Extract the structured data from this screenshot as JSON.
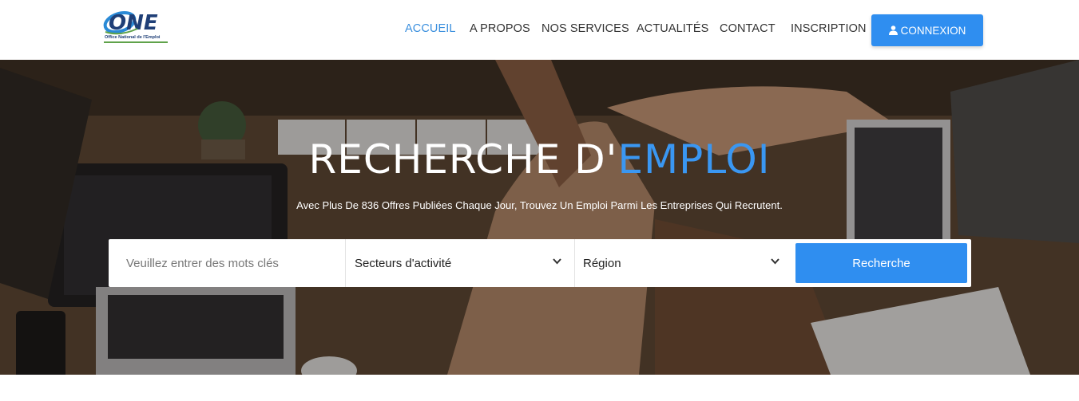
{
  "brand": {
    "logo_tagline": "Office National de l'Emploi",
    "accent_color": "#2f8ef0",
    "green_color": "#5fa24a"
  },
  "nav": {
    "items": [
      {
        "label": "ACCUEIL",
        "active": true
      },
      {
        "label": "A PROPOS",
        "active": false
      },
      {
        "label": "NOS SERVICES",
        "active": false
      },
      {
        "label": "ACTUALITÉS",
        "active": false
      },
      {
        "label": "CONTACT",
        "active": false
      },
      {
        "label": "INSCRIPTION",
        "active": false
      }
    ],
    "login_label": "CONNEXION",
    "login_icon": "user-icon"
  },
  "hero": {
    "title_main": "RECHERCHE D'",
    "title_accent": "EMPLOI",
    "subtitle": "Avec Plus De 836 Offres Publiées Chaque Jour, Trouvez Un Emploi Parmi Les Entreprises Qui Recrutent."
  },
  "search": {
    "keywords_placeholder": "Veuillez entrer des mots clés",
    "sector_label": "Secteurs d'activité",
    "region_label": "Région",
    "button_label": "Recherche"
  }
}
